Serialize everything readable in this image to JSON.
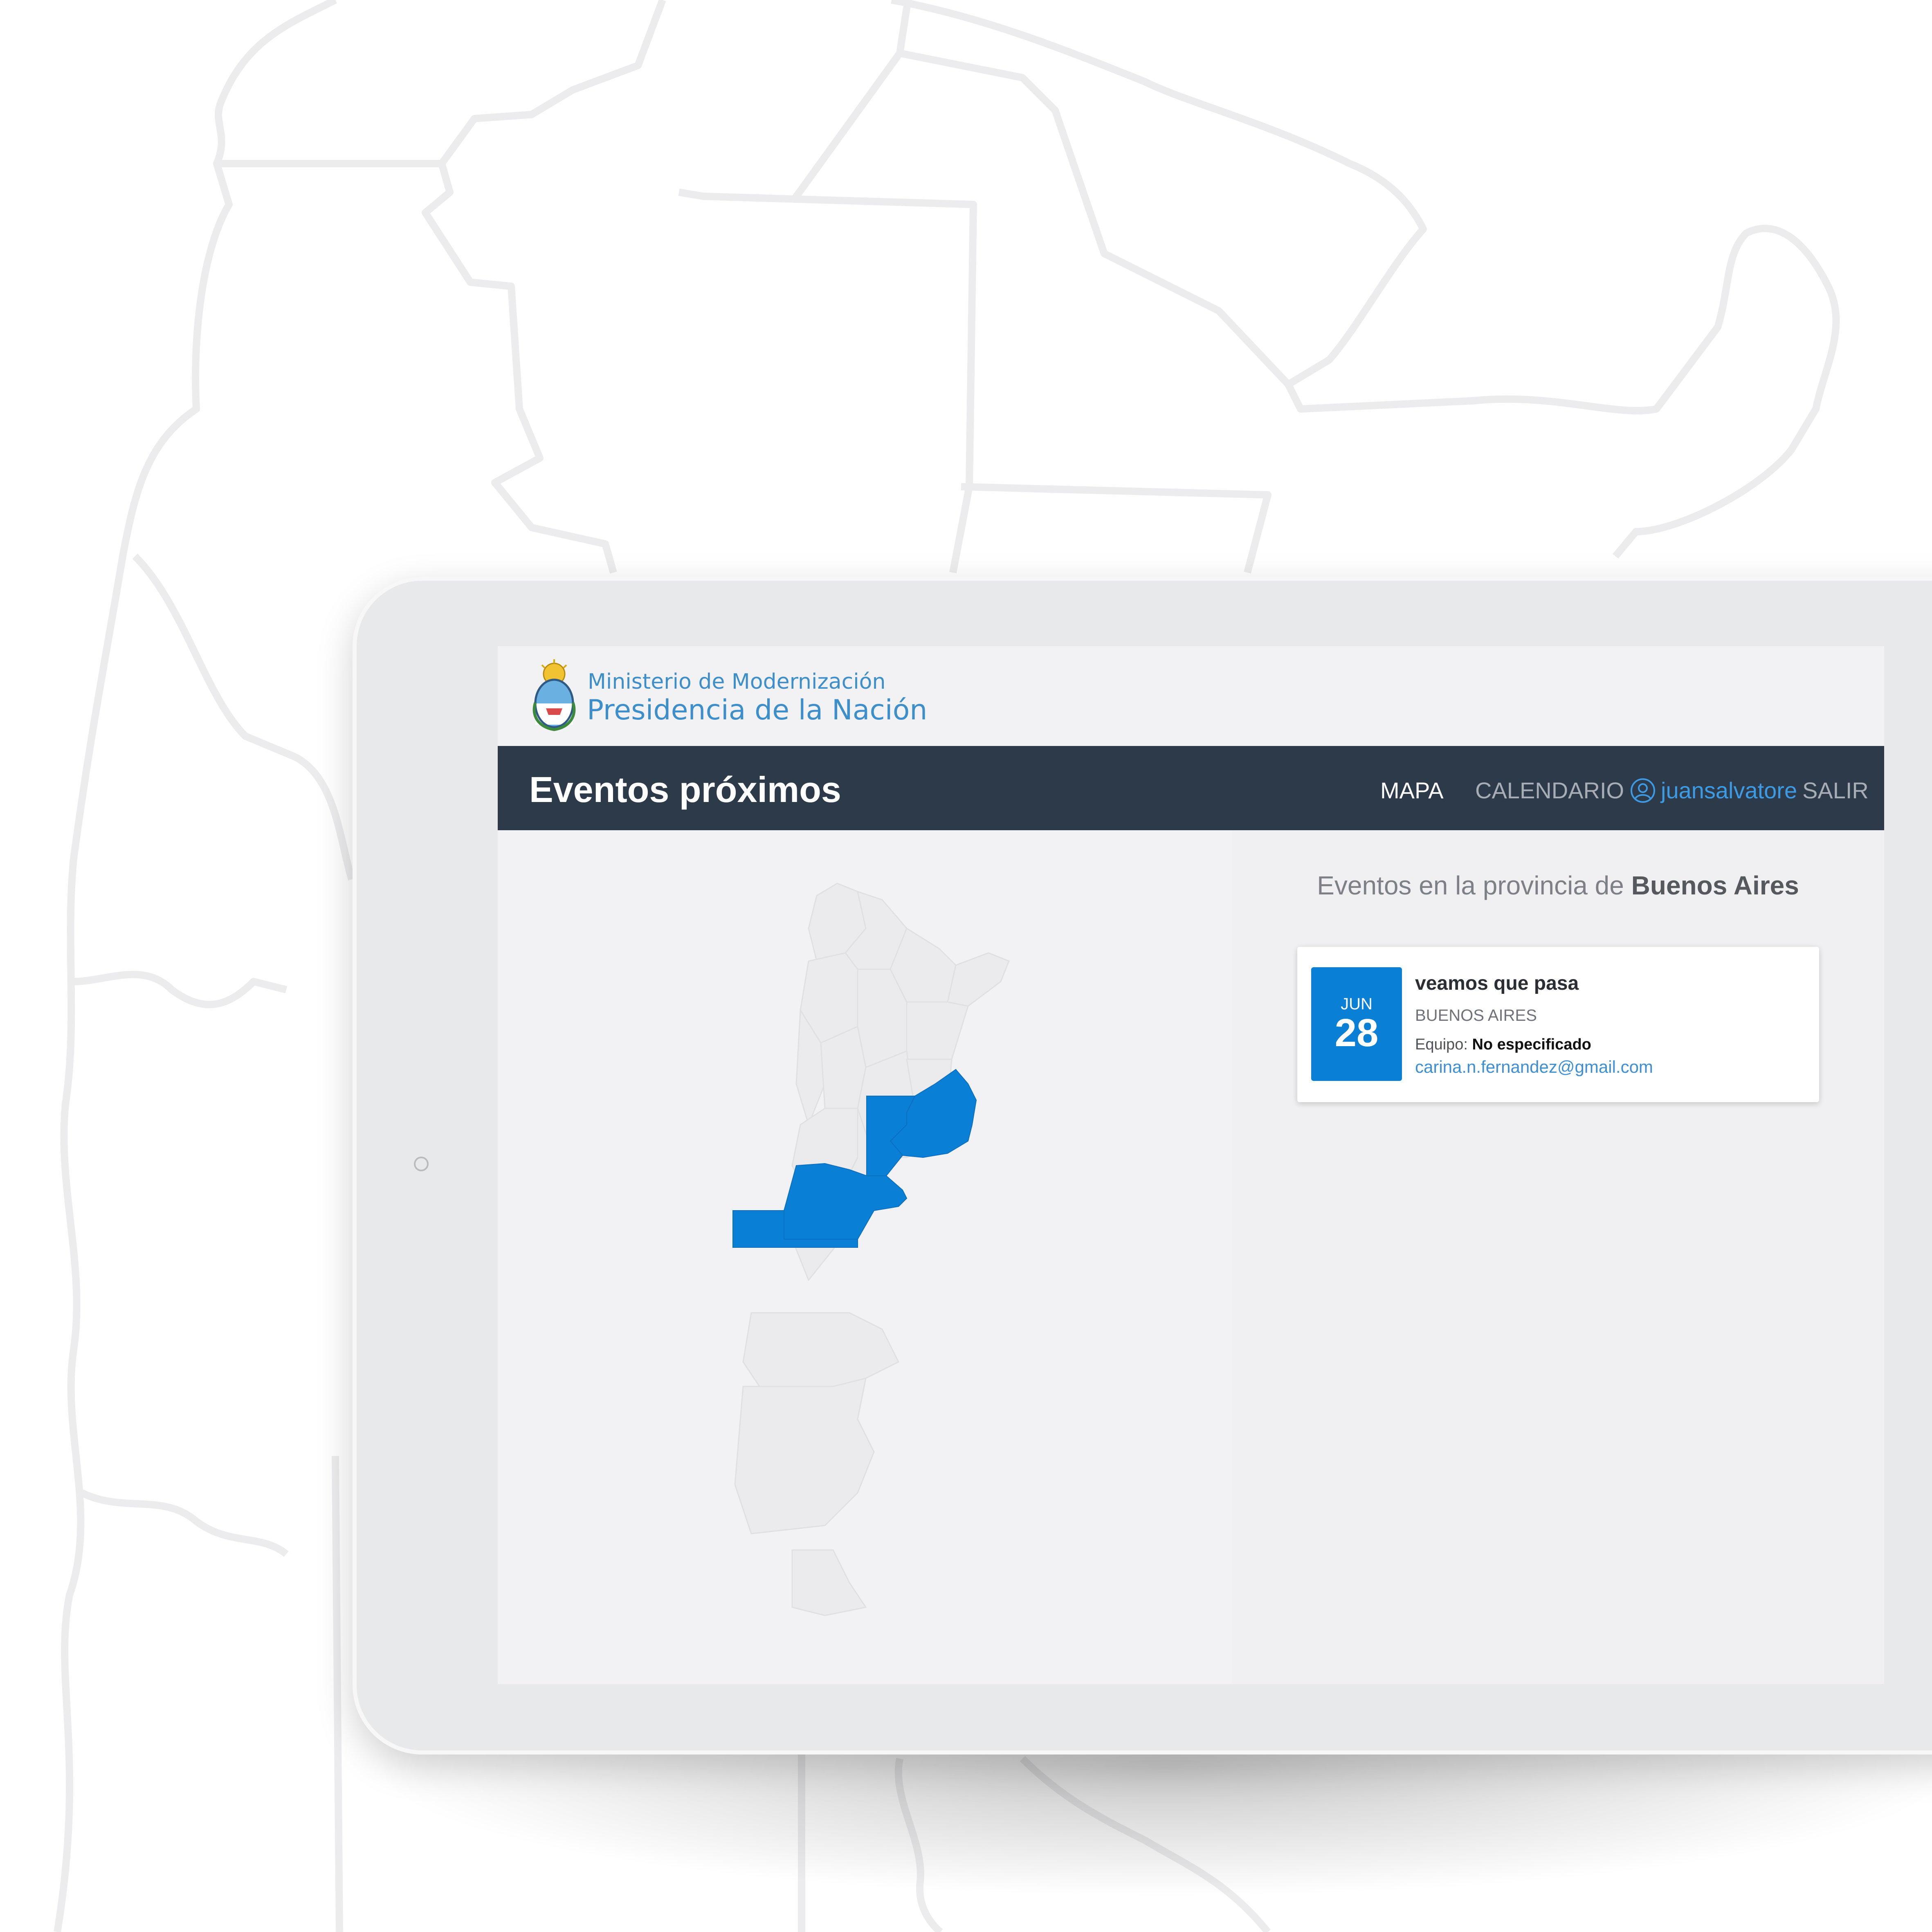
{
  "brand": {
    "ministry": "Ministerio de Modernización",
    "presidency": "Presidencia de la Nación"
  },
  "navbar": {
    "title": "Eventos próximos",
    "links": {
      "mapa": "MAPA",
      "calendario": "CALENDARIO",
      "user": "juansalvatore",
      "salir": "SALIR"
    },
    "active": "MAPA"
  },
  "events": {
    "heading_prefix": "Eventos en la provincia de",
    "province": "Buenos Aires",
    "items": [
      {
        "month": "JUN",
        "day": "28",
        "title": "veamos que pasa",
        "province": "BUENOS AIRES",
        "team_label": "Equipo:",
        "team_value": "No especificado",
        "email": "carina.n.fernandez@gmail.com"
      }
    ]
  },
  "colors": {
    "accent": "#0a7fd6",
    "navbar": "#2d3a4a",
    "brand_text": "#3d8fcb",
    "map_land": "#ebebed",
    "map_selected": "#0a7fd6"
  },
  "icons": {
    "user": "user-circle-icon",
    "coat": "coat-of-arms-icon"
  },
  "map": {
    "highlighted_provinces": [
      "Buenos Aires",
      "La Pampa",
      "Río Negro"
    ]
  }
}
